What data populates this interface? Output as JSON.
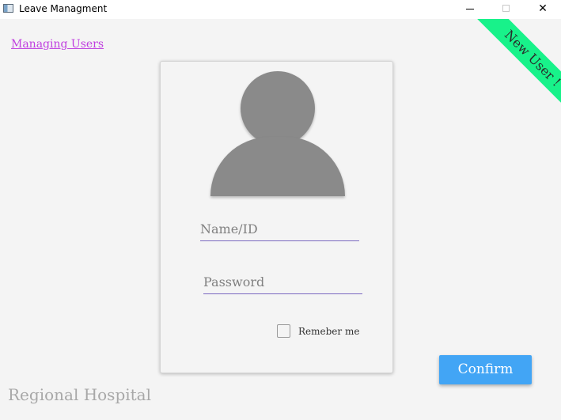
{
  "window": {
    "title": "Leave Managment",
    "minimize_symbol": "–",
    "maximize_symbol": "□",
    "close_symbol": "✕"
  },
  "header": {
    "link_label": "Managing Users",
    "ribbon_label": "New User !"
  },
  "form": {
    "name_placeholder": "Name/ID",
    "name_value": "",
    "password_placeholder": "Password",
    "password_value": "",
    "remember_label": "Remeber me",
    "remember_checked": false,
    "avatar_icon": "user-silhouette-icon"
  },
  "actions": {
    "confirm_label": "Confirm"
  },
  "footer": {
    "brand": "Regional Hospital"
  },
  "colors": {
    "accent": "#42a5f5",
    "ribbon": "#18f28a",
    "link": "#c040e0",
    "underline": "#7a68c0",
    "avatar": "#8a8a8a"
  }
}
